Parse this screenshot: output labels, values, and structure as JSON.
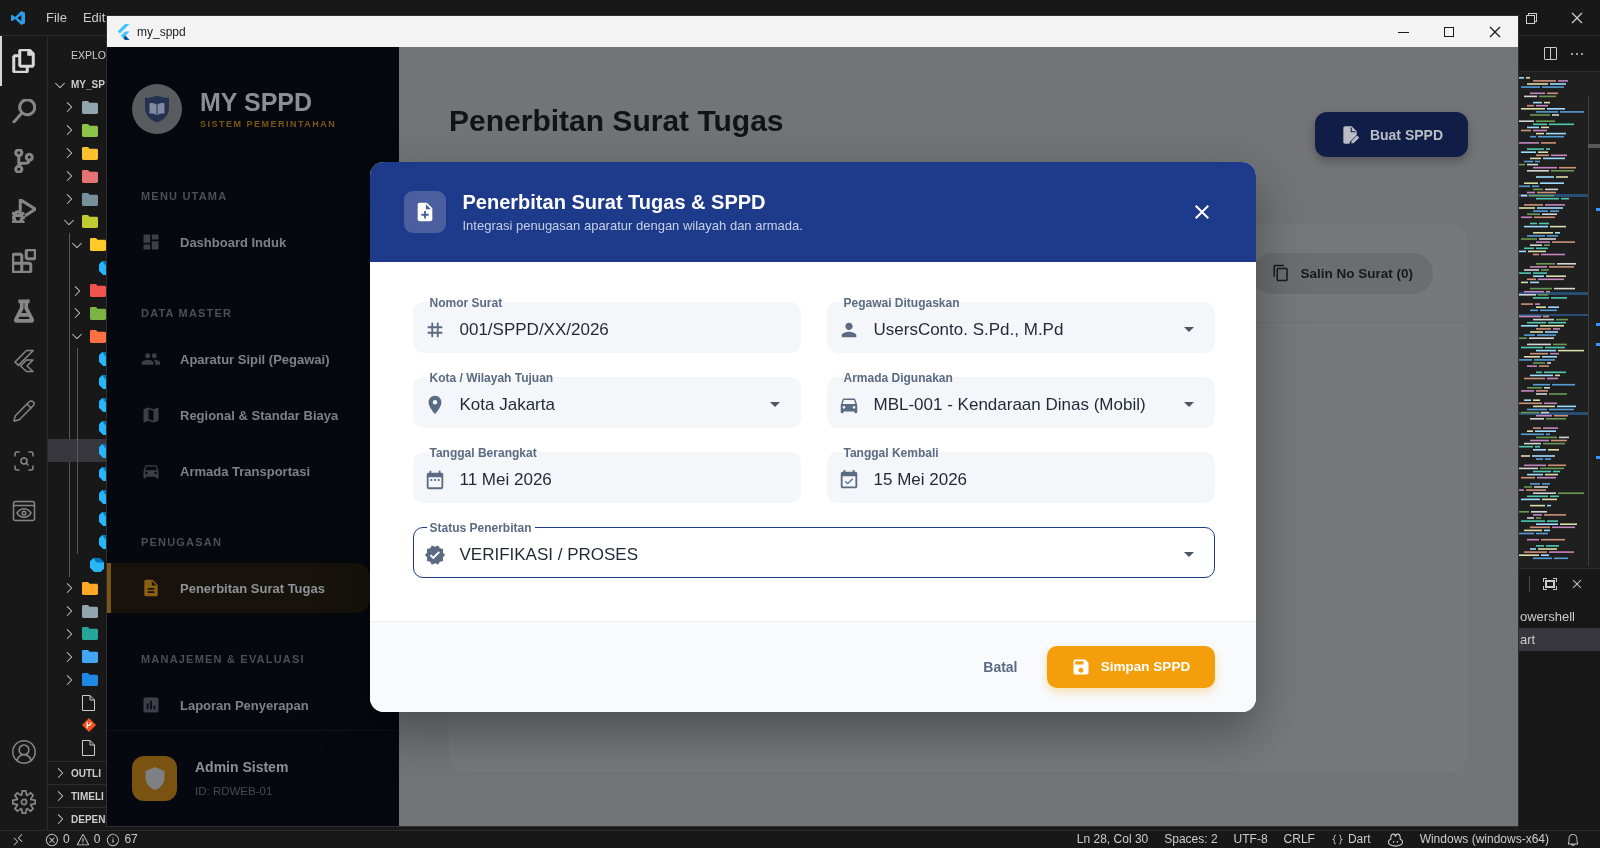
{
  "vscode": {
    "menu": [
      "File",
      "Edit"
    ],
    "activity_bar": [
      {
        "selected": true
      },
      {
        "selected": false
      },
      {
        "selected": false
      },
      {
        "selected": false
      },
      {
        "selected": false
      },
      {
        "selected": false
      },
      {
        "selected": false
      },
      {
        "selected": false
      },
      {
        "selected": false
      },
      {
        "selected": false
      }
    ],
    "explorer": {
      "title": "EXPLO",
      "root": {
        "label": "MY_SP",
        "expanded": true
      },
      "tree": [
        {
          "kind": "folder",
          "color": "#90a4ae",
          "expanded": false,
          "selected": false
        },
        {
          "kind": "folder",
          "color": "#8bc34a",
          "expanded": false,
          "selected": false
        },
        {
          "kind": "folder",
          "color": "#fbc02d",
          "expanded": false,
          "selected": false
        },
        {
          "kind": "folder",
          "color": "#e57373",
          "expanded": false,
          "selected": false
        },
        {
          "kind": "folder",
          "color": "#78909c",
          "expanded": false,
          "selected": false
        },
        {
          "kind": "folder",
          "color": "#c0ca33",
          "expanded": true,
          "selected": false,
          "children": [
            {
              "kind": "folder",
              "color": "#ffca28",
              "expanded": true,
              "selected": false,
              "children": [
                {
                  "kind": "dart",
                  "selected": false
                }
              ]
            },
            {
              "kind": "folder",
              "color": "#ef5350",
              "expanded": false,
              "selected": false
            },
            {
              "kind": "folder",
              "color": "#7cb342",
              "expanded": false,
              "selected": false
            },
            {
              "kind": "folder",
              "color": "#ff7043",
              "expanded": true,
              "selected": false,
              "children": [
                {
                  "kind": "dart",
                  "selected": false
                },
                {
                  "kind": "dart",
                  "selected": false
                },
                {
                  "kind": "dart",
                  "selected": false
                },
                {
                  "kind": "dart",
                  "selected": false
                },
                {
                  "kind": "dart",
                  "selected": true
                },
                {
                  "kind": "dart",
                  "selected": false
                },
                {
                  "kind": "dart",
                  "selected": false
                },
                {
                  "kind": "dart",
                  "selected": false
                },
                {
                  "kind": "dart",
                  "selected": false
                }
              ]
            },
            {
              "kind": "dart",
              "selected": false
            }
          ]
        },
        {
          "kind": "folder",
          "color": "#ffa726",
          "expanded": false,
          "selected": false
        },
        {
          "kind": "folder",
          "color": "#90a4ae",
          "expanded": false,
          "selected": false
        },
        {
          "kind": "folder",
          "color": "#26a69a",
          "expanded": false,
          "selected": false
        },
        {
          "kind": "folder",
          "color": "#42a5f5",
          "expanded": false,
          "selected": false
        },
        {
          "kind": "folder",
          "color": "#1e88e5",
          "expanded": false,
          "selected": false
        },
        {
          "kind": "file",
          "selected": false
        },
        {
          "kind": "git",
          "selected": false
        },
        {
          "kind": "file",
          "selected": false
        }
      ],
      "sections": [
        {
          "label": "OUTLI",
          "expanded": false
        },
        {
          "label": "TIMELI",
          "expanded": false
        },
        {
          "label": "DEPEN",
          "expanded": false
        }
      ]
    },
    "terminal_tabs": [
      {
        "label": "owershell",
        "selected": false
      },
      {
        "label": "art",
        "selected": true
      }
    ],
    "status_bar": {
      "problems": [
        {
          "kind": "error",
          "count": "0"
        },
        {
          "kind": "warning",
          "count": "0"
        },
        {
          "kind": "info",
          "count": "67"
        }
      ],
      "items": [
        {
          "kind": "text",
          "label": "Ln 28, Col 30"
        },
        {
          "kind": "text",
          "label": "Spaces: 2"
        },
        {
          "kind": "text",
          "label": "UTF-8"
        },
        {
          "kind": "text",
          "label": "CRLF"
        },
        {
          "kind": "language",
          "label": "Dart"
        },
        {
          "kind": "copilot"
        },
        {
          "kind": "text",
          "label": "Windows (windows-x64)"
        }
      ]
    }
  },
  "app_window": {
    "title": "my_sppd",
    "sidebar": {
      "brand": "MY SPPD",
      "tagline": "SISTEM PEMERINTAHAN",
      "sections": [
        {
          "title": "MENU UTAMA",
          "items": [
            {
              "label": "Dashboard Induk",
              "selected": false
            }
          ]
        },
        {
          "title": "DATA MASTER",
          "items": [
            {
              "label": "Aparatur Sipil (Pegawai)",
              "selected": false
            },
            {
              "label": "Regional & Standar Biaya",
              "selected": false
            },
            {
              "label": "Armada Transportasi",
              "selected": false
            }
          ]
        },
        {
          "title": "PENUGASAN",
          "items": [
            {
              "label": "Penerbitan Surat Tugas",
              "selected": true
            }
          ]
        },
        {
          "title": "MANAJEMEN & EVALUASI",
          "items": [
            {
              "label": "Laporan Penyerapan",
              "selected": false
            }
          ]
        }
      ],
      "user": {
        "name": "Admin Sistem",
        "id": "ID: RDWEB-01"
      }
    },
    "page": {
      "title": "Penerbitan Surat Tugas",
      "action": "Buat SPPD",
      "copy_button": "Salin No Surat (0)"
    },
    "dialog": {
      "title": "Penerbitan Surat Tugas & SPPD",
      "subtitle": "Integrasi penugasan aparatur dengan wilayah dan armada.",
      "rows": [
        [
          {
            "kind": "text",
            "label": "Nomor Surat",
            "value": "001/SPPD/XX/2026",
            "focused": false
          },
          {
            "kind": "dropdown",
            "label": "Pegawai Ditugaskan",
            "value": "UsersConto. S.Pd., M.Pd",
            "focused": false
          }
        ],
        [
          {
            "kind": "dropdown",
            "label": "Kota / Wilayah Tujuan",
            "value": "Kota Jakarta",
            "focused": false
          },
          {
            "kind": "dropdown",
            "label": "Armada Digunakan",
            "value": "MBL-001 - Kendaraan Dinas (Mobil)",
            "focused": false
          }
        ],
        [
          {
            "kind": "text",
            "label": "Tanggal Berangkat",
            "value": "11 Mei 2026",
            "focused": false
          },
          {
            "kind": "text",
            "label": "Tanggal Kembali",
            "value": "15 Mei 2026",
            "focused": false
          }
        ],
        [
          {
            "kind": "dropdown",
            "label": "Status Penerbitan",
            "value": "VERIFIKASI / PROSES",
            "focused": true
          }
        ]
      ],
      "cancel": "Batal",
      "submit": "Simpan SPPD"
    }
  }
}
